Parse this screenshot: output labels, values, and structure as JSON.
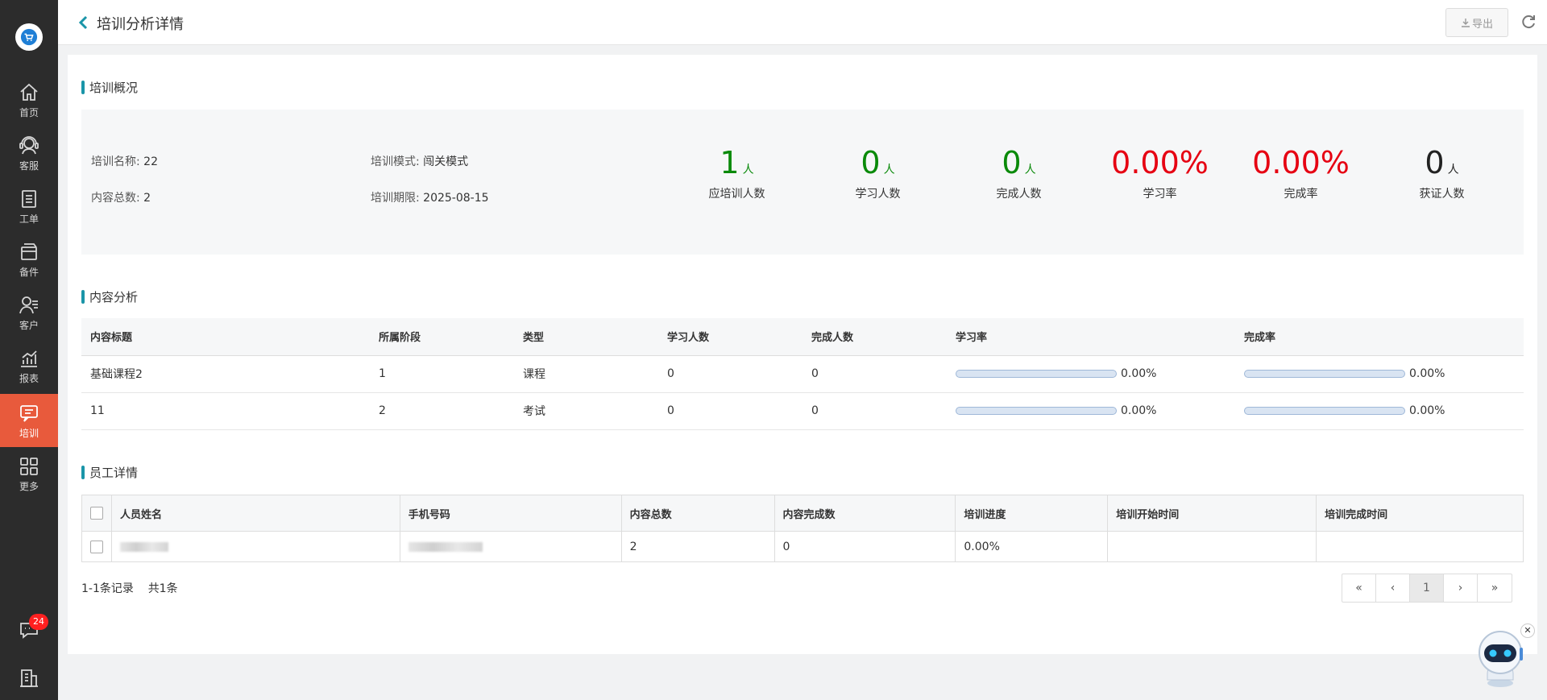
{
  "sidebar": {
    "items": [
      {
        "label": "首页",
        "icon": "home-icon"
      },
      {
        "label": "客服",
        "icon": "headset-icon"
      },
      {
        "label": "工单",
        "icon": "clipboard-icon"
      },
      {
        "label": "备件",
        "icon": "box-icon"
      },
      {
        "label": "客户",
        "icon": "customer-icon"
      },
      {
        "label": "报表",
        "icon": "chart-icon"
      },
      {
        "label": "培训",
        "icon": "training-icon",
        "active": true
      },
      {
        "label": "更多",
        "icon": "grid-icon"
      }
    ],
    "message_badge": "24",
    "accent_color": "#e85a3c"
  },
  "header": {
    "title": "培训分析详情",
    "export_label": "导出"
  },
  "overview": {
    "section_title": "培训概况",
    "name_key": "培训名称:",
    "name_value": "22",
    "mode_key": "培训模式:",
    "mode_value": "闯关模式",
    "total_key": "内容总数:",
    "total_value": "2",
    "deadline_key": "培训期限:",
    "deadline_value": "2025-08-15",
    "stats": [
      {
        "num": "1",
        "unit": "人",
        "label": "应培训人数",
        "color": "green"
      },
      {
        "num": "0",
        "unit": "人",
        "label": "学习人数",
        "color": "green"
      },
      {
        "num": "0",
        "unit": "人",
        "label": "完成人数",
        "color": "green"
      },
      {
        "num": "0.00%",
        "unit": "",
        "label": "学习率",
        "color": "red"
      },
      {
        "num": "0.00%",
        "unit": "",
        "label": "完成率",
        "color": "red"
      },
      {
        "num": "0",
        "unit": "人",
        "label": "获证人数",
        "color": "dark"
      }
    ]
  },
  "content_analysis": {
    "section_title": "内容分析",
    "headers": [
      "内容标题",
      "所属阶段",
      "类型",
      "学习人数",
      "完成人数",
      "学习率",
      "完成率"
    ],
    "rows": [
      {
        "title": "基础课程2",
        "stage": "1",
        "type": "课程",
        "learners": "0",
        "completers": "0",
        "learn_rate": "0.00%",
        "learn_rate_value": 0,
        "complete_rate": "0.00%",
        "complete_rate_value": 0
      },
      {
        "title": "11",
        "stage": "2",
        "type": "考试",
        "learners": "0",
        "completers": "0",
        "learn_rate": "0.00%",
        "learn_rate_value": 0,
        "complete_rate": "0.00%",
        "complete_rate_value": 0
      }
    ]
  },
  "employees": {
    "section_title": "员工详情",
    "headers": [
      "人员姓名",
      "手机号码",
      "内容总数",
      "内容完成数",
      "培训进度",
      "培训开始时间",
      "培训完成时间"
    ],
    "rows": [
      {
        "name": "",
        "phone": "",
        "total": "2",
        "done": "0",
        "progress": "0.00%",
        "start": "",
        "end": ""
      }
    ],
    "records_text": "1-1条记录",
    "total_text": "共1条"
  },
  "pagination": {
    "first": "«",
    "prev": "‹",
    "current": "1",
    "next": "›",
    "last": "»"
  },
  "colors": {
    "stat_green": "#0a8a0a",
    "stat_red": "#e60012",
    "section_accent": "#1a95a8"
  }
}
